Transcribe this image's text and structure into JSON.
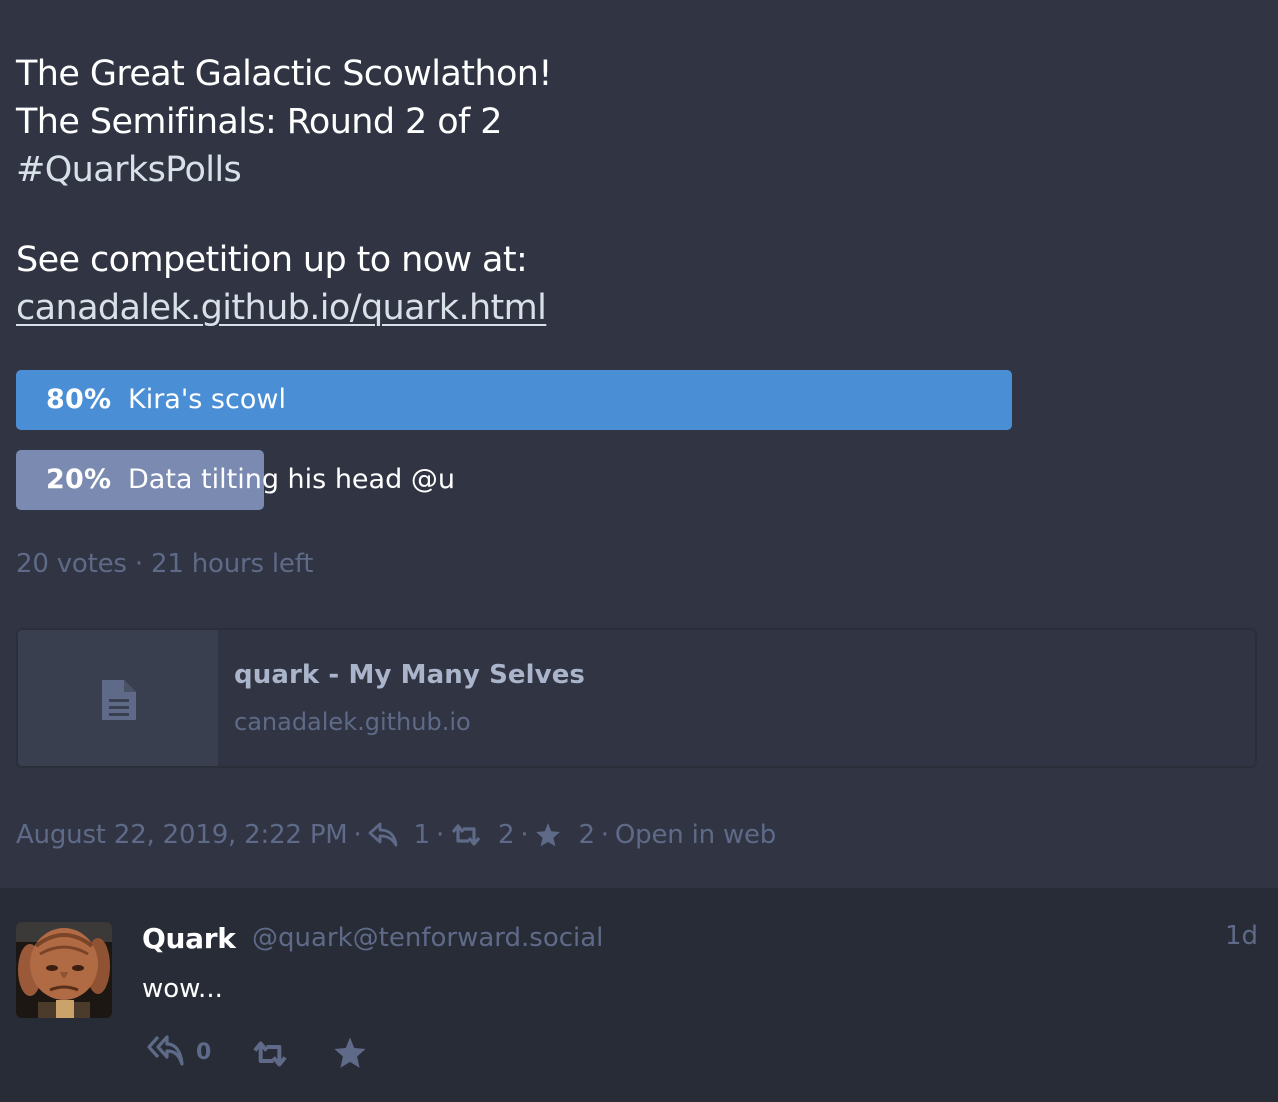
{
  "status": {
    "content": {
      "line1": "The Great Galactic Scowlathon!",
      "line2": "The Semifinals: Round 2 of 2",
      "hashtag": "#QuarksPolls",
      "line3": "See competition up to now at:",
      "link": "canadalek.github.io/quark.html"
    },
    "poll": {
      "options": [
        {
          "percent": "80%",
          "label": "Kira's scowl",
          "share": 0.8,
          "leading": true
        },
        {
          "percent": "20%",
          "label": "Data tilting his head @u",
          "share": 0.2,
          "leading": false
        }
      ],
      "meta": "20 votes · 21 hours left"
    },
    "card": {
      "title": "quark - My Many Selves",
      "host": "canadalek.github.io",
      "icon": "file-icon"
    },
    "detail": {
      "date": "August 22, 2019, 2:22 PM",
      "sep": "·",
      "reply_count": "1",
      "reblog_count": "2",
      "favourite_count": "2",
      "open_in_web": "Open in web"
    }
  },
  "reply": {
    "display_name": "Quark",
    "acct": "@quark@tenforward.social",
    "relative_time": "1d",
    "text": "wow...",
    "reply_count": "0"
  },
  "colors": {
    "background": "#313543",
    "reply_background": "#282c37",
    "poll_leading": "#4a8fd6",
    "poll_other": "#7a8ab0",
    "muted_text": "#5e6a87"
  }
}
